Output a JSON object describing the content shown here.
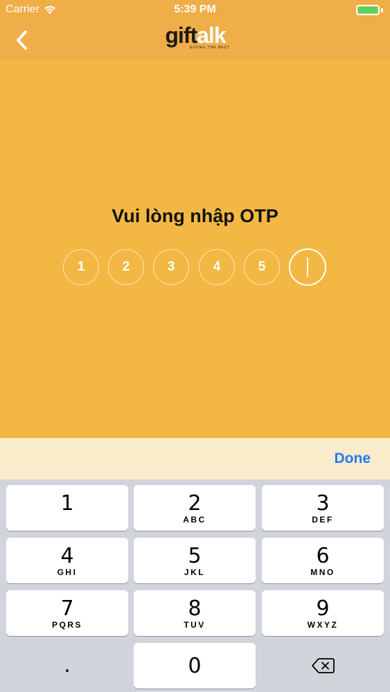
{
  "status_bar": {
    "carrier": "Carrier",
    "time": "5:39 PM",
    "battery_color": "#4CD964"
  },
  "nav": {
    "back_icon": "chevron-left-icon",
    "logo_gift": "gift",
    "logo_alk": "alk",
    "logo_tagline": "GIVING THE BEST"
  },
  "otp": {
    "title": "Vui lòng nhập OTP",
    "cells": [
      "1",
      "2",
      "3",
      "4",
      "5",
      ""
    ],
    "active_index": 5
  },
  "accessory": {
    "done_label": "Done"
  },
  "keyboard": {
    "keys": [
      {
        "digit": "1",
        "letters": ""
      },
      {
        "digit": "2",
        "letters": "ABC"
      },
      {
        "digit": "3",
        "letters": "DEF"
      },
      {
        "digit": "4",
        "letters": "GHI"
      },
      {
        "digit": "5",
        "letters": "JKL"
      },
      {
        "digit": "6",
        "letters": "MNO"
      },
      {
        "digit": "7",
        "letters": "PQRS"
      },
      {
        "digit": "8",
        "letters": "TUV"
      },
      {
        "digit": "9",
        "letters": "WXYZ"
      }
    ],
    "dot_label": ".",
    "zero_label": "0",
    "delete_icon": "backspace-icon"
  },
  "colors": {
    "background": "#F2B843",
    "nav_background": "#EFAE48",
    "accent_blue": "#1E7CF2",
    "accessory_background": "#FAEBCB",
    "keyboard_background": "#D1D4DA"
  }
}
